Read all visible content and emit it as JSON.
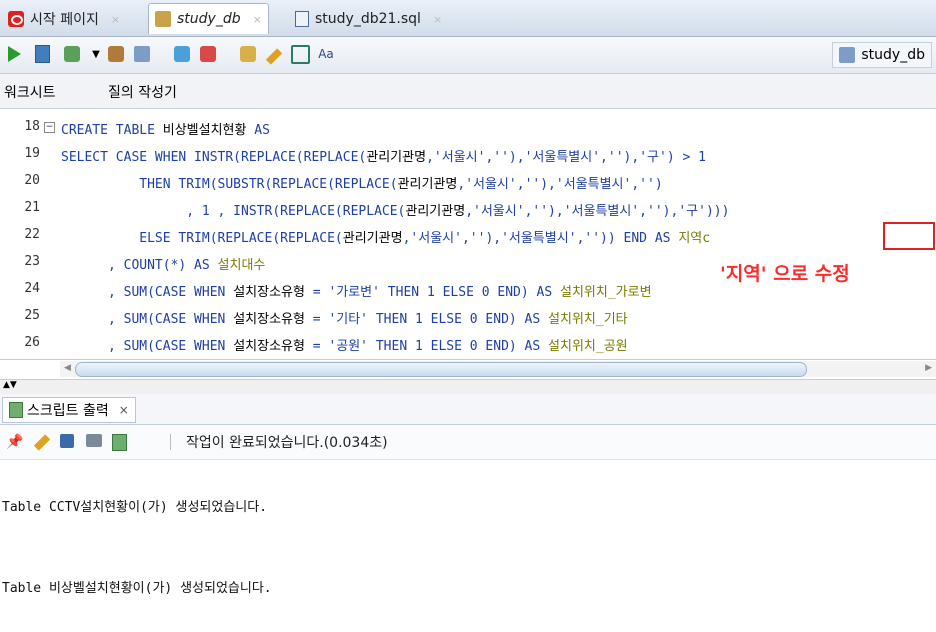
{
  "tabs": [
    {
      "label": "시작 페이지"
    },
    {
      "label": "study_db"
    },
    {
      "label": "study_db21.sql"
    }
  ],
  "tab_close": "×",
  "connection": "study_db",
  "subtabs": [
    "워크시트",
    "질의 작성기"
  ],
  "line_numbers": [
    "18",
    "19",
    "20",
    "21",
    "22",
    "23",
    "24",
    "25",
    "26"
  ],
  "code": {
    "l18a": "CREATE TABLE ",
    "l18b": "비상벨설치현황",
    "l18c": " AS",
    "l19": [
      "SELECT CASE WHEN INSTR(REPLACE(REPLACE(",
      "관리기관명",
      ",",
      "'서울시'",
      ",",
      "''",
      "),",
      "'서울특별시'",
      ",",
      "''",
      "),",
      "'구'",
      ") > 1"
    ],
    "l20": [
      "          THEN TRIM(SUBSTR(REPLACE(REPLACE(",
      "관리기관명",
      ",",
      "'서울시'",
      ",",
      "''",
      "),",
      "'서울특별시'",
      ",",
      "''",
      ")"
    ],
    "l21": [
      "                , 1 , INSTR(REPLACE(REPLACE(",
      "관리기관명",
      ",",
      "'서울시'",
      ",",
      "''",
      "),",
      "'서울특별시'",
      ",",
      "''",
      "),",
      "'구'",
      ")))"
    ],
    "l22": [
      "          ELSE TRIM(REPLACE(REPLACE(",
      "관리기관명",
      ",",
      "'서울시'",
      ",",
      "''",
      "),",
      "'서울특별시'",
      ",",
      "''",
      ")) END AS ",
      "지역c"
    ],
    "l23": [
      "      , COUNT(*) AS ",
      "설치대수"
    ],
    "l24": [
      "      , SUM(CASE WHEN ",
      "설치장소유형",
      " = ",
      "'가로변'",
      " THEN 1 ELSE 0 END) AS ",
      "설치위치_가로변"
    ],
    "l25": [
      "      , SUM(CASE WHEN ",
      "설치장소유형",
      " = ",
      "'기타'",
      " THEN 1 ELSE 0 END) AS ",
      "설치위치_기타"
    ],
    "l26": [
      "      , SUM(CASE WHEN ",
      "설치장소유형",
      " = ",
      "'공원'",
      " THEN 1 ELSE 0 END) AS ",
      "설치위치_공원"
    ]
  },
  "annotation": "'지역' 으로 수정",
  "output_tab": "스크립트 출력",
  "output_tab_close": "×",
  "status": "작업이 완료되었습니다.(0.034초)",
  "output_lines": [
    "Table CCTV설치현황이(가) 생성되었습니다.",
    "Table 비상벨설치현황이(가) 생성되었습니다."
  ],
  "colors": {
    "keyword": "#1e3fa6",
    "alias": "#7a7a00",
    "annotation": "#ff2a2a"
  }
}
